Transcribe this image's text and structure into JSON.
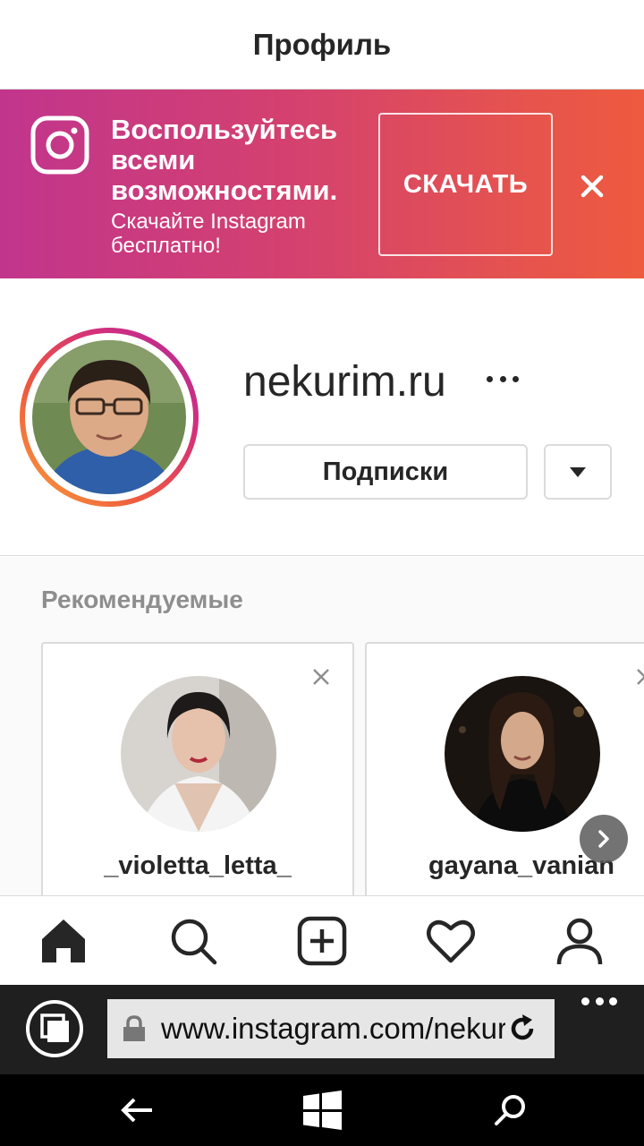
{
  "header": {
    "title": "Профиль"
  },
  "banner": {
    "heading": "Воспользуйтесь всеми возможностями.",
    "subtitle": "Скачайте Instagram бесплатно!",
    "download_label": "СКАЧАТЬ",
    "logo_icon": "instagram-logo-icon",
    "close_icon": "close-icon"
  },
  "profile": {
    "username": "nekurim.ru",
    "following_button": "Подписки",
    "more_icon": "more-dots-icon",
    "dropdown_icon": "caret-down-icon"
  },
  "suggestions": {
    "title": "Рекомендуемые",
    "cards": [
      {
        "username": "_violetta_letta_"
      },
      {
        "username": "gayana_vanian"
      }
    ]
  },
  "bottom_nav": {
    "items": [
      "home-icon",
      "search-icon",
      "new-post-icon",
      "activity-heart-icon",
      "profile-icon"
    ],
    "active": "home-icon"
  },
  "browser": {
    "url": "www.instagram.com/nekurim.ru/",
    "icons": [
      "tabs-icon",
      "lock-icon",
      "reload-icon",
      "more-icon"
    ]
  },
  "system_bar": {
    "icons": [
      "back-icon",
      "windows-start-icon",
      "search-icon"
    ]
  },
  "colors": {
    "banner_gradient_start": "#c1358d",
    "banner_gradient_end": "#ee5a3e",
    "text_primary": "#262626",
    "text_secondary": "#8e8e8e",
    "border": "#dbdbdb"
  }
}
